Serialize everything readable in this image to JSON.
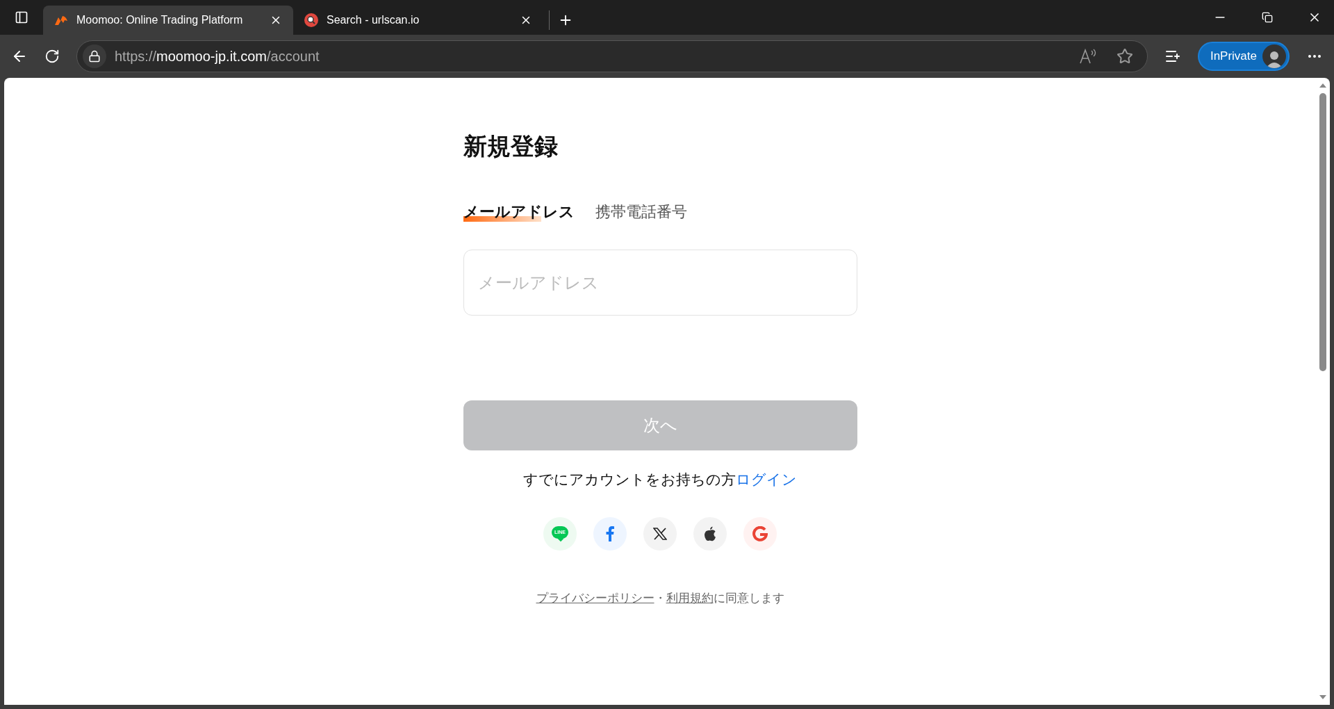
{
  "browser": {
    "tabs": [
      {
        "title": "Moomoo: Online Trading Platform",
        "selected": true,
        "kind": "moomoo"
      },
      {
        "title": "Search - urlscan.io",
        "selected": false,
        "kind": "urlscan"
      }
    ],
    "address": {
      "scheme": "https://",
      "host": "moomoo-jp.it.com",
      "path": "/account"
    },
    "profile": "InPrivate"
  },
  "page": {
    "title": "新規登録",
    "tabs": [
      {
        "label": "メールアドレス",
        "selected": true
      },
      {
        "label": "携帯電話番号",
        "selected": false
      }
    ],
    "email_field": {
      "placeholder": "メールアドレス"
    },
    "next_button": {
      "label": "次へ",
      "disabled": true
    },
    "login_prompt": {
      "text": "すでにアカウントをお持ちの方",
      "link": "ログイン"
    },
    "social_logins": [
      {
        "kind": "line",
        "label": "LINE"
      },
      {
        "kind": "facebook"
      },
      {
        "kind": "x"
      },
      {
        "kind": "apple"
      },
      {
        "kind": "google"
      }
    ],
    "consent": {
      "privacy_link": "プライバシーポリシー",
      "separator": "・",
      "terms_link": "利用規約",
      "suffix": "に同意します"
    }
  }
}
